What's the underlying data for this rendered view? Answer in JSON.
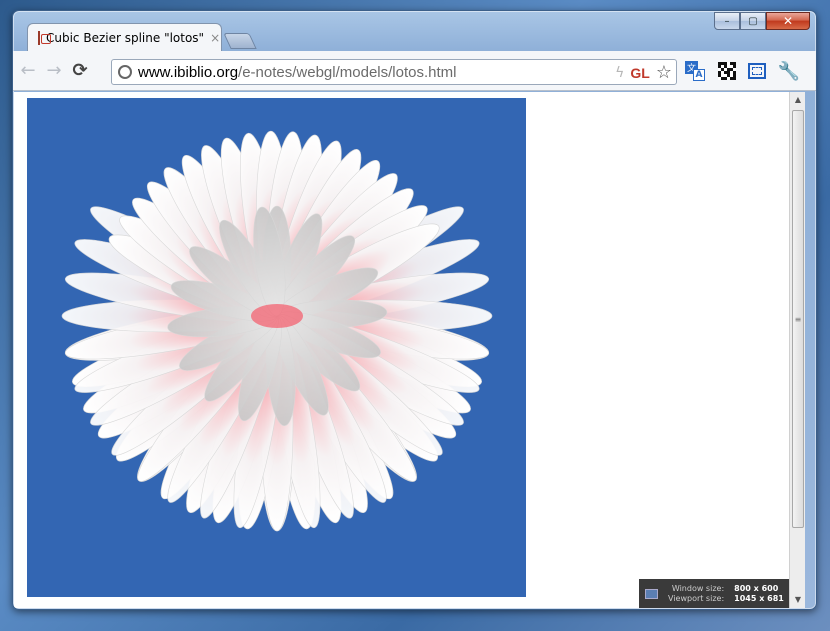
{
  "window": {
    "controls": {
      "minimize": "–",
      "maximize": "▢",
      "close": "✕"
    }
  },
  "tab": {
    "title": "Cubic Bezier spline \"lotos\"",
    "close": "×",
    "favicon": "webgl-favicon-icon"
  },
  "toolbar": {
    "back": "←",
    "forward": "→",
    "reload": "⟳",
    "url_host": "www.ibiblio.org",
    "url_path": "/e-notes/webgl/models/lotos.html",
    "bolt": "ϟ",
    "gl_badge": "GL",
    "star": "☆",
    "translate_a": "文",
    "translate_b": "A",
    "wrench": "🔧"
  },
  "content": {
    "canvas_bg": "#3366b3",
    "petal_tint": "#f06070"
  },
  "resolution": {
    "window_label": "Window size:",
    "window_value": "800 x 600",
    "viewport_label": "Viewport size:",
    "viewport_value": "1045 x 681"
  },
  "scrollbar": {
    "up": "▲",
    "down": "▼",
    "grip": "≡"
  }
}
